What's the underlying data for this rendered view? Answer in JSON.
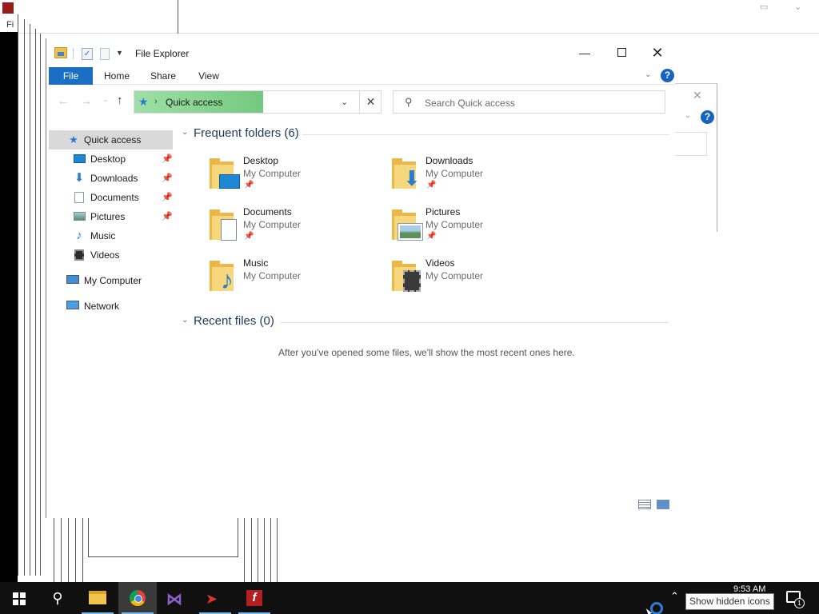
{
  "window": {
    "title": "File Explorer",
    "minimize_glyph": "—",
    "close_glyph": "✕"
  },
  "ribbon": {
    "tabs": [
      "File",
      "Home",
      "Share",
      "View"
    ],
    "help_label": "?"
  },
  "address": {
    "location": "Quick access",
    "separator": "›",
    "clear_glyph": "✕"
  },
  "search": {
    "placeholder": "Search Quick access"
  },
  "nav_pane": {
    "items": [
      {
        "label": "Quick access",
        "icon": "star-icon",
        "selected": true
      },
      {
        "label": "Desktop",
        "icon": "desktop-icon",
        "pinned": true
      },
      {
        "label": "Downloads",
        "icon": "download-arrow-icon",
        "pinned": true
      },
      {
        "label": "Documents",
        "icon": "document-icon",
        "pinned": true
      },
      {
        "label": "Pictures",
        "icon": "picture-icon",
        "pinned": true
      },
      {
        "label": "Music",
        "icon": "music-note-icon"
      },
      {
        "label": "Videos",
        "icon": "film-icon"
      },
      {
        "label": "My Computer",
        "icon": "computer-icon"
      },
      {
        "label": "Network",
        "icon": "network-icon"
      }
    ]
  },
  "frequent": {
    "title": "Frequent folders (6)",
    "folders": [
      {
        "name": "Desktop",
        "location": "My Computer",
        "pinned": true
      },
      {
        "name": "Downloads",
        "location": "My Computer",
        "pinned": true
      },
      {
        "name": "Documents",
        "location": "My Computer",
        "pinned": true
      },
      {
        "name": "Pictures",
        "location": "My Computer",
        "pinned": true
      },
      {
        "name": "Music",
        "location": "My Computer",
        "pinned": false
      },
      {
        "name": "Videos",
        "location": "My Computer",
        "pinned": false
      }
    ]
  },
  "recent": {
    "title": "Recent files (0)",
    "empty_message": "After you've opened some files, we'll show the most recent ones here."
  },
  "taskbar": {
    "clock": "9:53 AM",
    "notification_count": "1",
    "tooltip": "Show hidden icons",
    "apps": [
      "file-explorer",
      "chrome",
      "visual-studio",
      "arrow-app",
      "flash"
    ]
  },
  "background": {
    "menu_fragment": "Fi"
  },
  "colors": {
    "accent": "#1a6fc4",
    "address_highlight": "#73c97f",
    "taskbar": "#101010"
  }
}
